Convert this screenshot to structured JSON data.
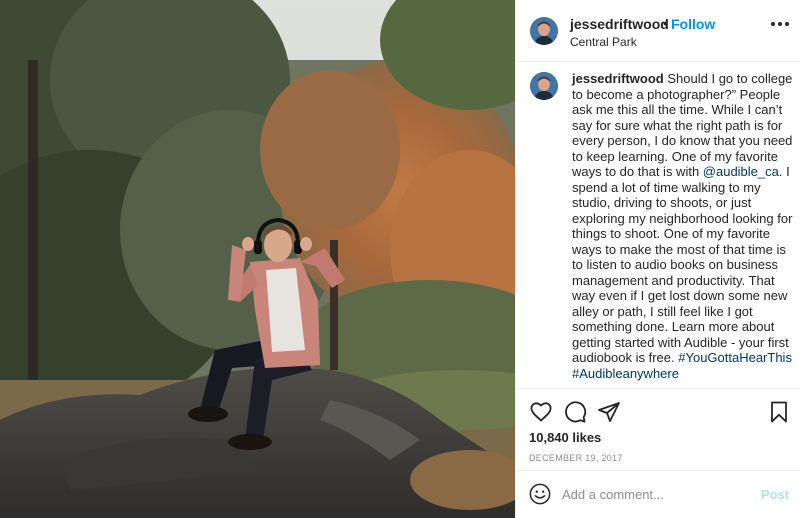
{
  "header": {
    "username": "jessedriftwood",
    "separator": "•",
    "follow_label": "Follow",
    "location": "Central Park",
    "avatar_icon": "profile-avatar",
    "more_icon": "more-options-icon"
  },
  "caption": {
    "username": "jessedriftwood",
    "text_before_mention": "Should I go to college to become a photographer?” People ask me this all the time. While I can’t say for sure what the right path is for every person, I do know that you need to keep learning. One of my favorite ways to do that is with ",
    "mention": "@audible_ca",
    "text_after_mention": ". I spend a lot of time walking to my studio, driving to shoots, or just exploring my neighborhood looking for things to shoot. One of my favorite ways to make the most of that time is to listen to audio books on business management and productivity. That way even if I get lost down some new alley or path, I still feel like I got something done. Learn more about getting started with Audible - your first audiobook is free.",
    "hashtags": [
      "#YouGottaHearThis",
      "#Audibleanywhere"
    ]
  },
  "actions": {
    "icons": [
      "heart-icon",
      "comment-icon",
      "share-icon",
      "bookmark-icon"
    ],
    "likes": "10,840 likes",
    "date": "DECEMBER 19, 2017"
  },
  "comment_box": {
    "placeholder": "Add a comment...",
    "post_label": "Post",
    "emoji_icon": "emoji-icon"
  },
  "colors": {
    "accent": "#0095f6",
    "link": "#00376b",
    "muted": "#8e8e8e",
    "border": "#efefef"
  }
}
